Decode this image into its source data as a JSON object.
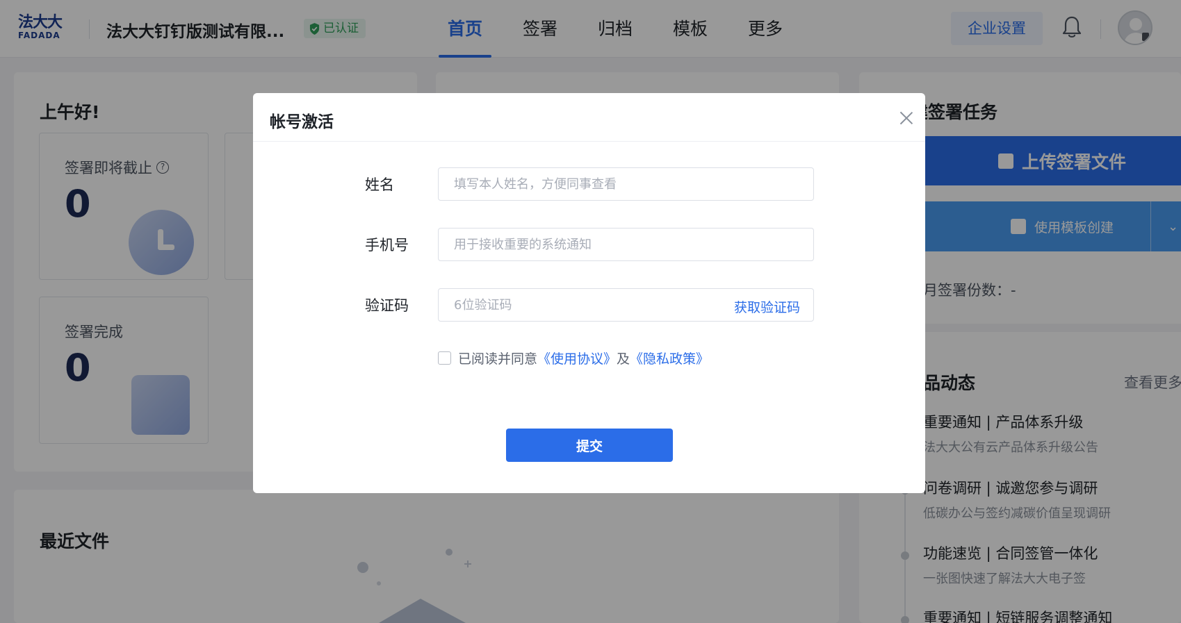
{
  "header": {
    "logo_cn": "法大大",
    "logo_en": "FADADA",
    "company_name": "法大大钉钉版测试有限...",
    "verified_badge": "已认证",
    "nav": [
      {
        "label": "首页"
      },
      {
        "label": "签署"
      },
      {
        "label": "归档"
      },
      {
        "label": "模板"
      },
      {
        "label": "更多"
      }
    ],
    "active_nav": "首页",
    "org_settings_label": "企业设置"
  },
  "dashboard": {
    "greeting": "上午好!",
    "stats": [
      {
        "label": "签署即将截止",
        "value": "0"
      },
      {
        "label": "签署完成",
        "value": "0"
      }
    ],
    "recent_files_title": "最近文件"
  },
  "right_panel": {
    "title": "建签署任务",
    "upload_button": "上传签署文件",
    "template_button": "使用模板创建",
    "monthly_label": "月签署份数：",
    "monthly_value": "-",
    "news_title": "品动态",
    "more_link": "查看更多",
    "news": [
      {
        "title": "重要通知 | 产品体系升级",
        "subtitle": "法大大公有云产品体系升级公告"
      },
      {
        "title": "问卷调研 | 诚邀您参与调研",
        "subtitle": "低碳办公与签约减碳价值呈现调研"
      },
      {
        "title": "功能速览 | 合同签管一体化",
        "subtitle": "一张图快速了解法大大电子签"
      },
      {
        "title": "重要通知 | 短链服务调整通知",
        "subtitle": ""
      }
    ]
  },
  "modal": {
    "title": "帐号激活",
    "fields": {
      "name": {
        "label": "姓名",
        "value": "",
        "placeholder": "填写本人姓名，方便同事查看"
      },
      "phone": {
        "label": "手机号",
        "value": "",
        "placeholder": "用于接收重要的系统通知"
      },
      "code": {
        "label": "验证码",
        "value": "",
        "placeholder": "6位验证码",
        "action": "获取验证码"
      }
    },
    "agreement": {
      "checked": false,
      "prefix": "已阅读并同意",
      "terms": "《使用协议》",
      "joiner": "及",
      "privacy": "《隐私政策》"
    },
    "submit_label": "提交"
  },
  "colors": {
    "primary": "#2b6de8",
    "verified_green": "#2f9e5a",
    "mask": "rgba(0,0,0,0.40)"
  }
}
